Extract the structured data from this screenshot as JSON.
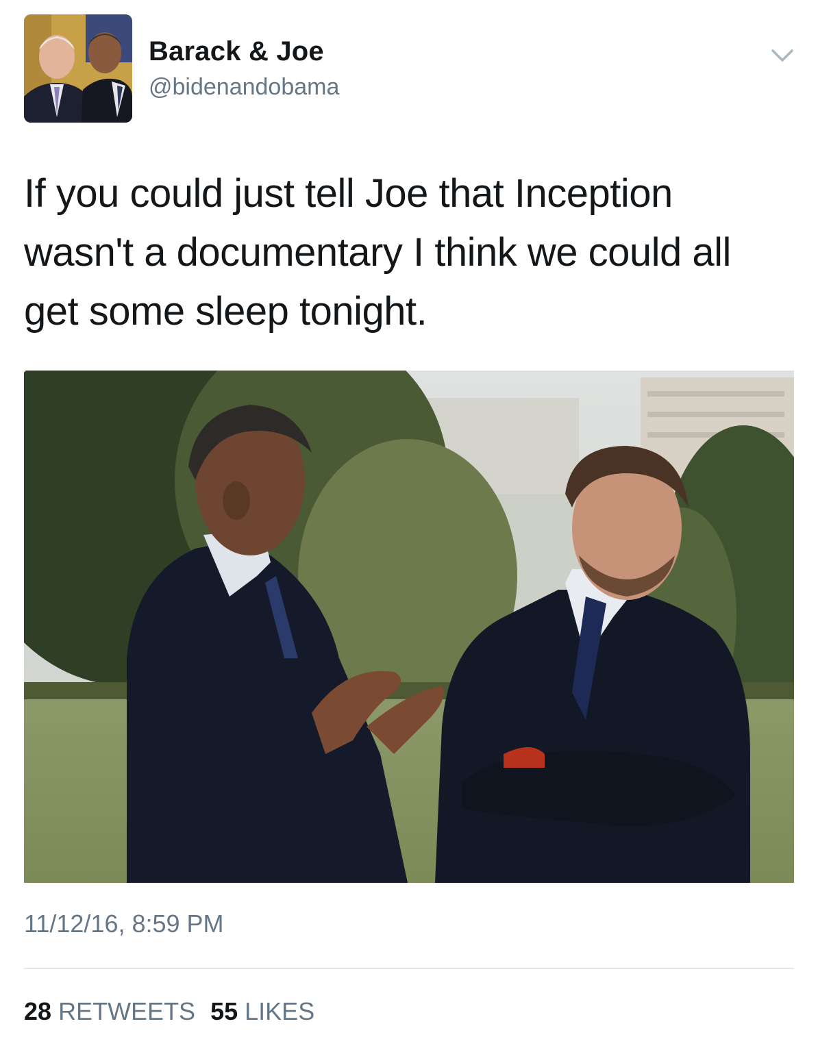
{
  "author": {
    "display_name": "Barack & Joe",
    "handle": "@bidenandobama",
    "avatar_icon": "profile-photo",
    "menu_icon": "chevron-down-icon"
  },
  "tweet": {
    "text": "If you could just tell Joe that Inception wasn't a documentary I think we could all get some sleep tonight.",
    "timestamp": "11/12/16, 8:59 PM"
  },
  "media": {
    "type": "photo",
    "description_icon": "photo-two-men-in-suits-on-lawn"
  },
  "stats": {
    "retweets_count": "28",
    "retweets_label": "RETWEETS",
    "likes_count": "55",
    "likes_label": "LIKES"
  },
  "colors": {
    "text_primary": "#14171a",
    "text_secondary": "#657786",
    "divider": "#e1e8ed"
  }
}
